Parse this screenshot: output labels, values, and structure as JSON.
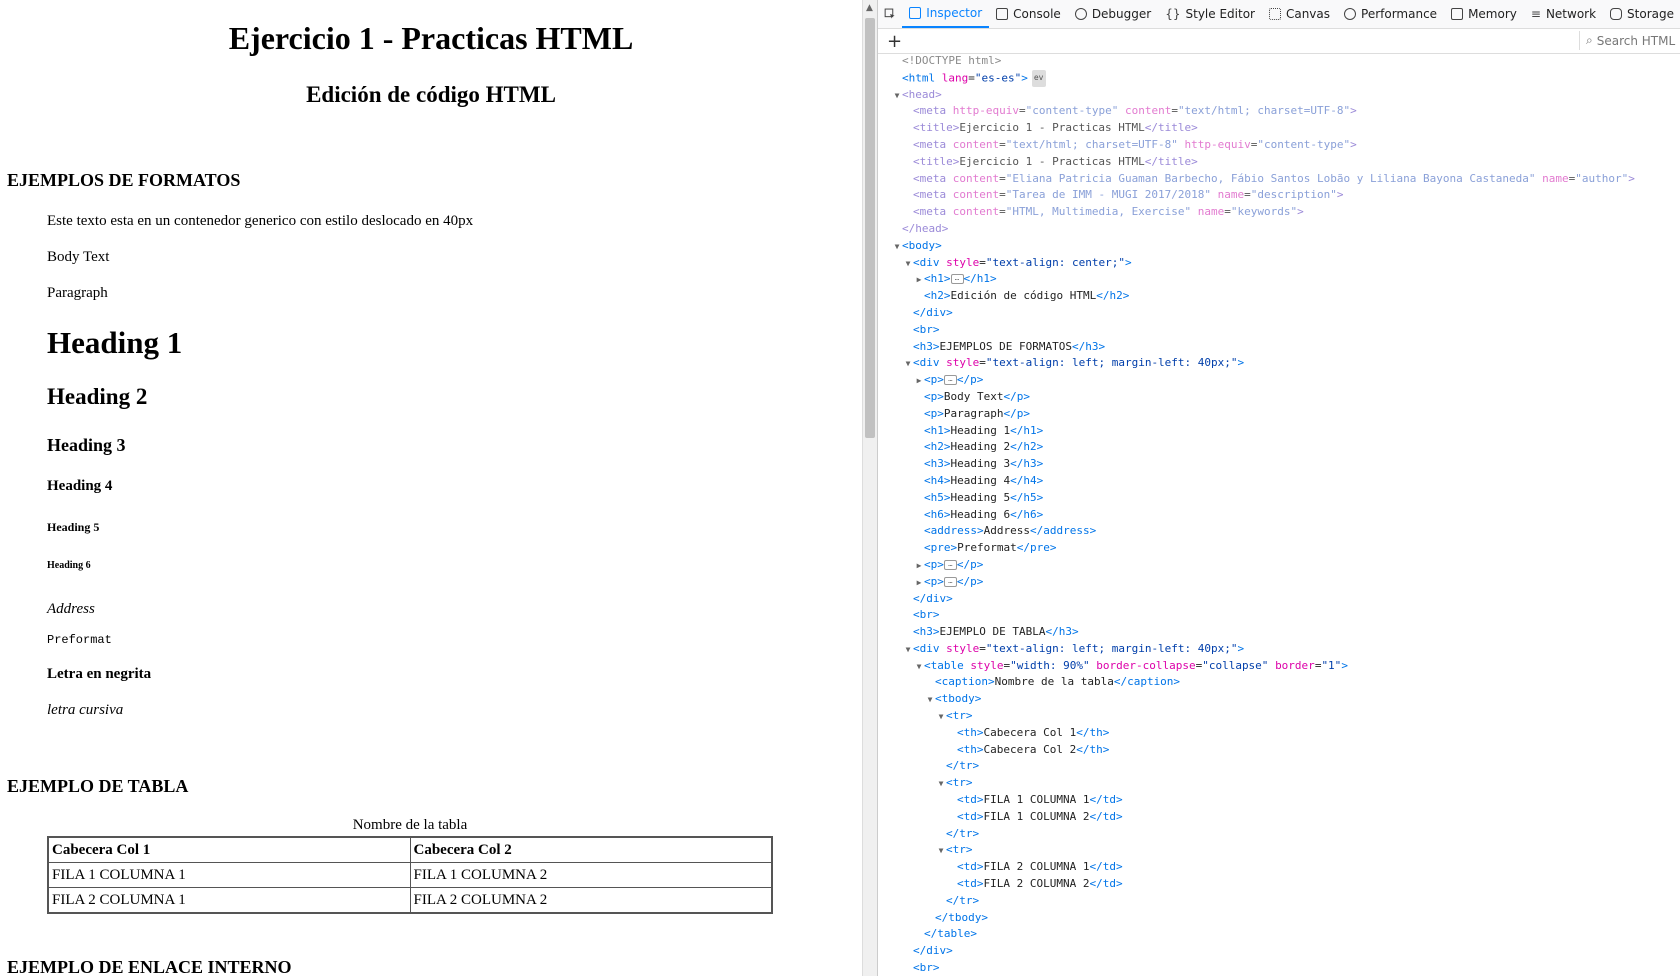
{
  "page": {
    "h1": "Ejercicio 1 - Practicas HTML",
    "h2": "Edición de código HTML",
    "section_formats": "EJEMPLOS DE FORMATOS",
    "para_shifted": "Este texto esta en un contenedor generico con estilo deslocado en 40px",
    "body_text": "Body Text",
    "paragraph": "Paragraph",
    "heading1": "Heading 1",
    "heading2": "Heading 2",
    "heading3": "Heading 3",
    "heading4": "Heading 4",
    "heading5": "Heading 5",
    "heading6": "Heading 6",
    "address": "Address",
    "preformat": "Preformat",
    "bold": "Letra en negrita",
    "italic": "letra cursiva",
    "section_table": "EJEMPLO DE TABLA",
    "table_caption": "Nombre de la tabla",
    "table": {
      "headers": [
        "Cabecera Col 1",
        "Cabecera Col 2"
      ],
      "rows": [
        [
          "FILA 1 COLUMNA 1",
          "FILA 1 COLUMNA 2"
        ],
        [
          "FILA 2 COLUMNA 1",
          "FILA 2 COLUMNA 2"
        ]
      ]
    },
    "section_link": "EJEMPLO DE ENLACE INTERNO"
  },
  "devtools": {
    "tabs": [
      "Inspector",
      "Console",
      "Debugger",
      "Style Editor",
      "Canvas",
      "Performance",
      "Memory",
      "Network",
      "Storage"
    ],
    "active_tab": "Inspector",
    "search_placeholder": "Search HTML",
    "tab_icons": [
      "inspector-icon",
      "console-icon",
      "debugger-icon",
      "style-editor-icon",
      "canvas-icon",
      "performance-icon",
      "memory-icon",
      "network-icon",
      "storage-icon"
    ],
    "colors": {
      "accent": "#0a84ff",
      "tag": "#0074e8",
      "attr": "#dd00a9",
      "value": "#003eaa"
    },
    "markup": [
      {
        "d": 0,
        "tw": "",
        "c": "dim",
        "p": [
          [
            "tag",
            "<!DOCTYPE html>"
          ]
        ]
      },
      {
        "d": 0,
        "tw": "",
        "p": [
          [
            "tag",
            "<html"
          ],
          [
            "txt",
            " "
          ],
          [
            "attr",
            "lang"
          ],
          [
            "txt",
            "="
          ],
          [
            "val",
            "\"es-es\""
          ],
          [
            "tag",
            ">"
          ]
        ],
        "ev": "ev"
      },
      {
        "d": 0,
        "tw": "▼",
        "c": "head-dim",
        "p": [
          [
            "tag",
            "<head>"
          ]
        ]
      },
      {
        "d": 1,
        "tw": "",
        "c": "head-dim",
        "p": [
          [
            "tag",
            "<meta"
          ],
          [
            "txt",
            " "
          ],
          [
            "attr",
            "http-equiv"
          ],
          [
            "txt",
            "="
          ],
          [
            "val",
            "\"content-type\""
          ],
          [
            "txt",
            " "
          ],
          [
            "attr",
            "content"
          ],
          [
            "txt",
            "="
          ],
          [
            "val",
            "\"text/html; charset=UTF-8\""
          ],
          [
            "tag",
            ">"
          ]
        ]
      },
      {
        "d": 1,
        "tw": "",
        "c": "head-dim",
        "p": [
          [
            "tag",
            "<title>"
          ],
          [
            "txt",
            "Ejercicio 1 - Practicas HTML"
          ],
          [
            "tag",
            "</title>"
          ]
        ]
      },
      {
        "d": 1,
        "tw": "",
        "c": "head-dim",
        "p": [
          [
            "tag",
            "<meta"
          ],
          [
            "txt",
            " "
          ],
          [
            "attr",
            "content"
          ],
          [
            "txt",
            "="
          ],
          [
            "val",
            "\"text/html; charset=UTF-8\""
          ],
          [
            "txt",
            " "
          ],
          [
            "attr",
            "http-equiv"
          ],
          [
            "txt",
            "="
          ],
          [
            "val",
            "\"content-type\""
          ],
          [
            "tag",
            ">"
          ]
        ]
      },
      {
        "d": 1,
        "tw": "",
        "c": "head-dim",
        "p": [
          [
            "tag",
            "<title>"
          ],
          [
            "txt",
            "Ejercicio 1 - Practicas HTML"
          ],
          [
            "tag",
            "</title>"
          ]
        ]
      },
      {
        "d": 1,
        "tw": "",
        "c": "head-dim",
        "p": [
          [
            "tag",
            "<meta"
          ],
          [
            "txt",
            " "
          ],
          [
            "attr",
            "content"
          ],
          [
            "txt",
            "="
          ],
          [
            "val",
            "\"Eliana Patricia Guaman Barbecho, Fábio Santos Lobão y Liliana Bayona Castaneda\""
          ],
          [
            "txt",
            " "
          ],
          [
            "attr",
            "name"
          ],
          [
            "txt",
            "="
          ],
          [
            "val",
            "\"author\""
          ],
          [
            "tag",
            ">"
          ]
        ]
      },
      {
        "d": 1,
        "tw": "",
        "c": "head-dim",
        "p": [
          [
            "tag",
            "<meta"
          ],
          [
            "txt",
            " "
          ],
          [
            "attr",
            "content"
          ],
          [
            "txt",
            "="
          ],
          [
            "val",
            "\"Tarea de IMM - MUGI 2017/2018\""
          ],
          [
            "txt",
            " "
          ],
          [
            "attr",
            "name"
          ],
          [
            "txt",
            "="
          ],
          [
            "val",
            "\"description\""
          ],
          [
            "tag",
            ">"
          ]
        ]
      },
      {
        "d": 1,
        "tw": "",
        "c": "head-dim",
        "p": [
          [
            "tag",
            "<meta"
          ],
          [
            "txt",
            " "
          ],
          [
            "attr",
            "content"
          ],
          [
            "txt",
            "="
          ],
          [
            "val",
            "\"HTML, Multimedia, Exercise\""
          ],
          [
            "txt",
            " "
          ],
          [
            "attr",
            "name"
          ],
          [
            "txt",
            "="
          ],
          [
            "val",
            "\"keywords\""
          ],
          [
            "tag",
            ">"
          ]
        ]
      },
      {
        "d": 0,
        "tw": "",
        "c": "head-dim",
        "p": [
          [
            "tag",
            "</head>"
          ]
        ]
      },
      {
        "d": 0,
        "tw": "▼",
        "p": [
          [
            "tag",
            "<body>"
          ]
        ]
      },
      {
        "d": 1,
        "tw": "▼",
        "p": [
          [
            "tag",
            "<div"
          ],
          [
            "txt",
            " "
          ],
          [
            "attr",
            "style"
          ],
          [
            "txt",
            "="
          ],
          [
            "val",
            "\"text-align: center;\""
          ],
          [
            "tag",
            ">"
          ]
        ]
      },
      {
        "d": 2,
        "tw": "▶",
        "p": [
          [
            "tag",
            "<h1>"
          ],
          [
            "ell",
            ""
          ],
          [
            "tag",
            "</h1>"
          ]
        ]
      },
      {
        "d": 2,
        "tw": "",
        "p": [
          [
            "tag",
            "<h2>"
          ],
          [
            "txt",
            "Edición de código HTML"
          ],
          [
            "tag",
            "</h2>"
          ]
        ]
      },
      {
        "d": 1,
        "tw": "",
        "p": [
          [
            "tag",
            "</div>"
          ]
        ]
      },
      {
        "d": 1,
        "tw": "",
        "p": [
          [
            "tag",
            "<br>"
          ]
        ]
      },
      {
        "d": 1,
        "tw": "",
        "p": [
          [
            "tag",
            "<h3>"
          ],
          [
            "txt",
            "EJEMPLOS DE FORMATOS"
          ],
          [
            "tag",
            "</h3>"
          ]
        ]
      },
      {
        "d": 1,
        "tw": "▼",
        "p": [
          [
            "tag",
            "<div"
          ],
          [
            "txt",
            " "
          ],
          [
            "attr",
            "style"
          ],
          [
            "txt",
            "="
          ],
          [
            "val",
            "\"text-align: left; margin-left: 40px;\""
          ],
          [
            "tag",
            ">"
          ]
        ]
      },
      {
        "d": 2,
        "tw": "▶",
        "p": [
          [
            "tag",
            "<p>"
          ],
          [
            "ell",
            ""
          ],
          [
            "tag",
            "</p>"
          ]
        ]
      },
      {
        "d": 2,
        "tw": "",
        "p": [
          [
            "tag",
            "<p>"
          ],
          [
            "txt",
            "Body Text"
          ],
          [
            "tag",
            "</p>"
          ]
        ]
      },
      {
        "d": 2,
        "tw": "",
        "p": [
          [
            "tag",
            "<p>"
          ],
          [
            "txt",
            "Paragraph"
          ],
          [
            "tag",
            "</p>"
          ]
        ]
      },
      {
        "d": 2,
        "tw": "",
        "p": [
          [
            "tag",
            "<h1>"
          ],
          [
            "txt",
            "Heading 1"
          ],
          [
            "tag",
            "</h1>"
          ]
        ]
      },
      {
        "d": 2,
        "tw": "",
        "p": [
          [
            "tag",
            "<h2>"
          ],
          [
            "txt",
            "Heading 2"
          ],
          [
            "tag",
            "</h2>"
          ]
        ]
      },
      {
        "d": 2,
        "tw": "",
        "p": [
          [
            "tag",
            "<h3>"
          ],
          [
            "txt",
            "Heading 3"
          ],
          [
            "tag",
            "</h3>"
          ]
        ]
      },
      {
        "d": 2,
        "tw": "",
        "p": [
          [
            "tag",
            "<h4>"
          ],
          [
            "txt",
            "Heading 4"
          ],
          [
            "tag",
            "</h4>"
          ]
        ]
      },
      {
        "d": 2,
        "tw": "",
        "p": [
          [
            "tag",
            "<h5>"
          ],
          [
            "txt",
            "Heading 5"
          ],
          [
            "tag",
            "</h5>"
          ]
        ]
      },
      {
        "d": 2,
        "tw": "",
        "p": [
          [
            "tag",
            "<h6>"
          ],
          [
            "txt",
            "Heading 6"
          ],
          [
            "tag",
            "</h6>"
          ]
        ]
      },
      {
        "d": 2,
        "tw": "",
        "p": [
          [
            "tag",
            "<address>"
          ],
          [
            "txt",
            "Address"
          ],
          [
            "tag",
            "</address>"
          ]
        ]
      },
      {
        "d": 2,
        "tw": "",
        "p": [
          [
            "tag",
            "<pre>"
          ],
          [
            "txt",
            "Preformat"
          ],
          [
            "tag",
            "</pre>"
          ]
        ]
      },
      {
        "d": 2,
        "tw": "▶",
        "p": [
          [
            "tag",
            "<p>"
          ],
          [
            "ell",
            ""
          ],
          [
            "tag",
            "</p>"
          ]
        ]
      },
      {
        "d": 2,
        "tw": "▶",
        "p": [
          [
            "tag",
            "<p>"
          ],
          [
            "ell",
            ""
          ],
          [
            "tag",
            "</p>"
          ]
        ]
      },
      {
        "d": 1,
        "tw": "",
        "p": [
          [
            "tag",
            "</div>"
          ]
        ]
      },
      {
        "d": 1,
        "tw": "",
        "p": [
          [
            "tag",
            "<br>"
          ]
        ]
      },
      {
        "d": 1,
        "tw": "",
        "p": [
          [
            "tag",
            "<h3>"
          ],
          [
            "txt",
            "EJEMPLO DE TABLA"
          ],
          [
            "tag",
            "</h3>"
          ]
        ]
      },
      {
        "d": 1,
        "tw": "▼",
        "p": [
          [
            "tag",
            "<div"
          ],
          [
            "txt",
            " "
          ],
          [
            "attr",
            "style"
          ],
          [
            "txt",
            "="
          ],
          [
            "val",
            "\"text-align: left; margin-left: 40px;\""
          ],
          [
            "tag",
            ">"
          ]
        ]
      },
      {
        "d": 2,
        "tw": "▼",
        "p": [
          [
            "tag",
            "<table"
          ],
          [
            "txt",
            " "
          ],
          [
            "attr",
            "style"
          ],
          [
            "txt",
            "="
          ],
          [
            "val",
            "\"width: 90%\""
          ],
          [
            "txt",
            " "
          ],
          [
            "attr",
            "border-collapse"
          ],
          [
            "txt",
            "="
          ],
          [
            "val",
            "\"collapse\""
          ],
          [
            "txt",
            " "
          ],
          [
            "attr",
            "border"
          ],
          [
            "txt",
            "="
          ],
          [
            "val",
            "\"1\""
          ],
          [
            "tag",
            ">"
          ]
        ]
      },
      {
        "d": 3,
        "tw": "",
        "p": [
          [
            "tag",
            "<caption>"
          ],
          [
            "txt",
            "Nombre de la tabla"
          ],
          [
            "tag",
            "</caption>"
          ]
        ]
      },
      {
        "d": 3,
        "tw": "▼",
        "p": [
          [
            "tag",
            "<tbody>"
          ]
        ]
      },
      {
        "d": 4,
        "tw": "▼",
        "p": [
          [
            "tag",
            "<tr>"
          ]
        ]
      },
      {
        "d": 5,
        "tw": "",
        "p": [
          [
            "tag",
            "<th>"
          ],
          [
            "txt",
            "Cabecera Col 1"
          ],
          [
            "tag",
            "</th>"
          ]
        ]
      },
      {
        "d": 5,
        "tw": "",
        "p": [
          [
            "tag",
            "<th>"
          ],
          [
            "txt",
            "Cabecera Col 2"
          ],
          [
            "tag",
            "</th>"
          ]
        ]
      },
      {
        "d": 4,
        "tw": "",
        "p": [
          [
            "tag",
            "</tr>"
          ]
        ]
      },
      {
        "d": 4,
        "tw": "▼",
        "p": [
          [
            "tag",
            "<tr>"
          ]
        ]
      },
      {
        "d": 5,
        "tw": "",
        "p": [
          [
            "tag",
            "<td>"
          ],
          [
            "txt",
            "FILA 1 COLUMNA 1"
          ],
          [
            "tag",
            "</td>"
          ]
        ]
      },
      {
        "d": 5,
        "tw": "",
        "p": [
          [
            "tag",
            "<td>"
          ],
          [
            "txt",
            "FILA 1 COLUMNA 2"
          ],
          [
            "tag",
            "</td>"
          ]
        ]
      },
      {
        "d": 4,
        "tw": "",
        "p": [
          [
            "tag",
            "</tr>"
          ]
        ]
      },
      {
        "d": 4,
        "tw": "▼",
        "p": [
          [
            "tag",
            "<tr>"
          ]
        ]
      },
      {
        "d": 5,
        "tw": "",
        "p": [
          [
            "tag",
            "<td>"
          ],
          [
            "txt",
            "FILA 2 COLUMNA 1"
          ],
          [
            "tag",
            "</td>"
          ]
        ]
      },
      {
        "d": 5,
        "tw": "",
        "p": [
          [
            "tag",
            "<td>"
          ],
          [
            "txt",
            "FILA 2 COLUMNA 2"
          ],
          [
            "tag",
            "</td>"
          ]
        ]
      },
      {
        "d": 4,
        "tw": "",
        "p": [
          [
            "tag",
            "</tr>"
          ]
        ]
      },
      {
        "d": 3,
        "tw": "",
        "p": [
          [
            "tag",
            "</tbody>"
          ]
        ]
      },
      {
        "d": 2,
        "tw": "",
        "p": [
          [
            "tag",
            "</table>"
          ]
        ]
      },
      {
        "d": 1,
        "tw": "",
        "p": [
          [
            "tag",
            "</div>"
          ]
        ]
      },
      {
        "d": 1,
        "tw": "",
        "p": [
          [
            "tag",
            "<br>"
          ]
        ]
      }
    ]
  }
}
